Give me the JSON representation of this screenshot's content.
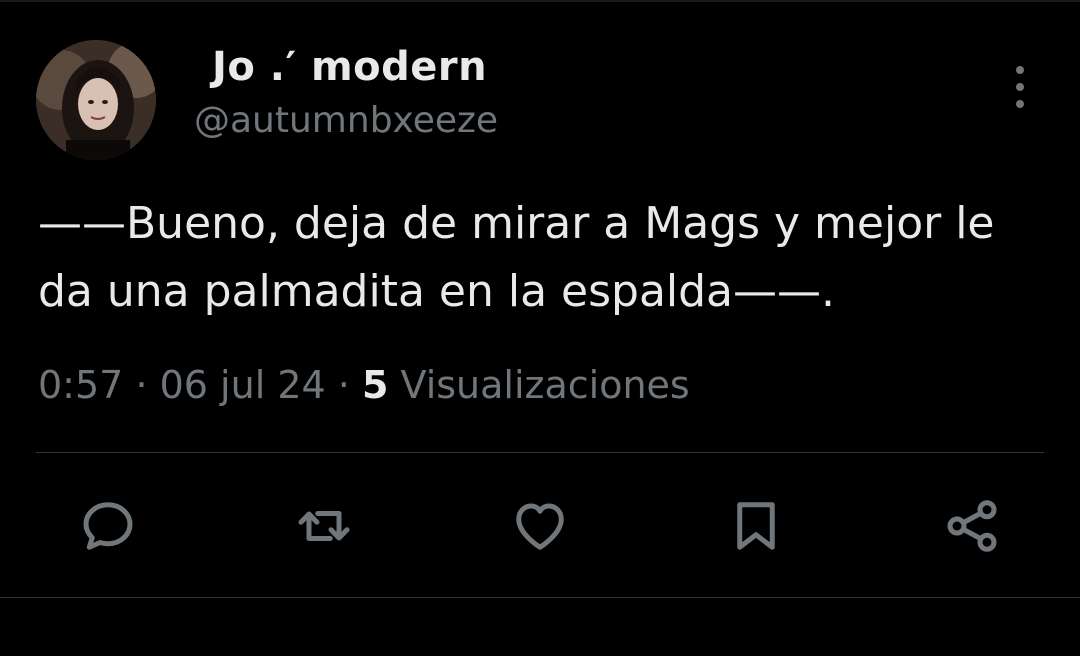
{
  "author": {
    "display_name": "Jo .′ modern",
    "handle": "@autumnbxeeze"
  },
  "tweet": {
    "text": "——Bueno, deja de mirar a Mags y mejor le da una palmadita en la espalda——."
  },
  "meta": {
    "time": "0:57",
    "separator": "·",
    "date": "06 jul 24",
    "views_count": "5",
    "views_label": "Visualizaciones"
  },
  "actions": {
    "reply_icon": "reply-icon",
    "retweet_icon": "retweet-icon",
    "like_icon": "heart-icon",
    "bookmark_icon": "bookmark-icon",
    "share_icon": "share-icon"
  },
  "colors": {
    "background": "#000000",
    "text_primary": "#e7e9ea",
    "text_secondary": "#71767b",
    "divider": "#2f3336"
  }
}
